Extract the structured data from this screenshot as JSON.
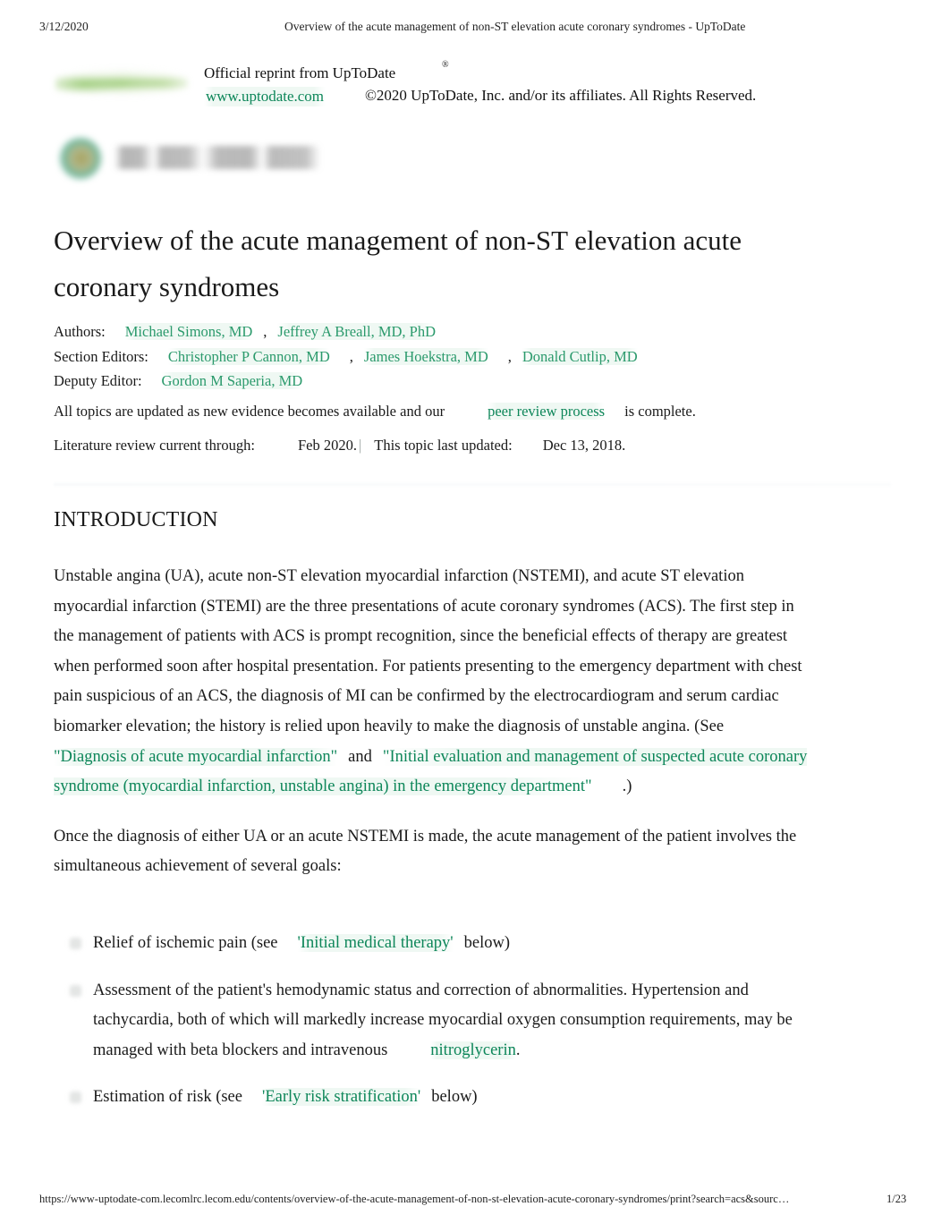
{
  "print_header": {
    "date": "3/12/2020",
    "title": "Overview of the acute management of non-ST elevation acute coronary syndromes - UpToDate"
  },
  "reprint": {
    "official_line": "Official reprint from UpToDate",
    "registered_mark": "®",
    "url": "www.uptodate.com",
    "copyright": "©2020 UpToDate, Inc. and/or its affiliates. All Rights Reserved.",
    "logo_alt": "uptodate-logo",
    "institution_logo_alt": "institution-logo"
  },
  "document": {
    "title": "Overview of the acute management of non-ST elevation acute coronary syndromes"
  },
  "credits": {
    "authors_label": "Authors:",
    "authors": [
      "Michael Simons, MD",
      "Jeffrey A Breall, MD, PhD"
    ],
    "section_editors_label": "Section Editors:",
    "section_editors": [
      "Christopher P Cannon, MD",
      "James Hoekstra, MD",
      "Donald Cutlip, MD"
    ],
    "deputy_editor_label": "Deputy Editor:",
    "deputy_editors": [
      "Gordon M Saperia, MD"
    ],
    "comma": ","
  },
  "update_notice": {
    "text_before": "All topics are updated as new evidence becomes available and our",
    "link": "peer review process",
    "text_after": "is complete.",
    "literature_label": "Literature review current through:",
    "literature_value": "Feb 2020.",
    "separator": "|",
    "last_updated_label": "This topic last updated:",
    "last_updated_value": "Dec 13, 2018."
  },
  "section": {
    "heading": "INTRODUCTION"
  },
  "paragraphs": {
    "p1_part1": "Unstable angina (UA), acute non-ST elevation myocardial infarction (NSTEMI), and acute ST elevation myocardial infarction (STEMI) are the three presentations of acute coronary syndromes (ACS). The first step in the management of patients with ACS is prompt recognition, since the beneficial effects of therapy are greatest when performed soon after hospital presentation. For patients presenting to the emergency department with chest pain suspicious of an ACS, the diagnosis of MI can be confirmed by the electrocardiogram and serum cardiac biomarker elevation; the history is relied upon heavily to make the diagnosis of unstable angina. (See",
    "p1_link1": "\"Diagnosis of acute myocardial infarction\"",
    "p1_and": "and",
    "p1_link2": "\"Initial evaluation and management of suspected acute coronary syndrome (myocardial infarction, unstable angina) in the emergency department\"",
    "p1_end": ".)",
    "p2": "Once the diagnosis of either UA or an acute NSTEMI is made, the acute management of the patient involves the simultaneous achievement of several goals:"
  },
  "goals": [
    {
      "text_before": "Relief of ischemic pain (see",
      "link": "'Initial medical therapy'",
      "text_after": "below)"
    },
    {
      "text_before": "Assessment of the patient's hemodynamic status and correction of abnormalities. Hypertension and tachycardia, both of which will markedly increase myocardial oxygen consumption requirements, may be managed with beta blockers and intravenous",
      "link": "nitroglycerin",
      "text_after": "."
    },
    {
      "text_before": "Estimation of risk (see",
      "link": "'Early risk stratification'",
      "text_after": "below)"
    }
  ],
  "print_footer": {
    "url": "https://www-uptodate-com.lecomlrc.lecom.edu/contents/overview-of-the-acute-management-of-non-st-elevation-acute-coronary-syndromes/print?search=acs&sourc…",
    "page": "1/23"
  },
  "colors": {
    "link_green": "#2b9a6c",
    "link_green_dark": "#0d8659",
    "text": "#1a1a1a",
    "background": "#ffffff"
  }
}
